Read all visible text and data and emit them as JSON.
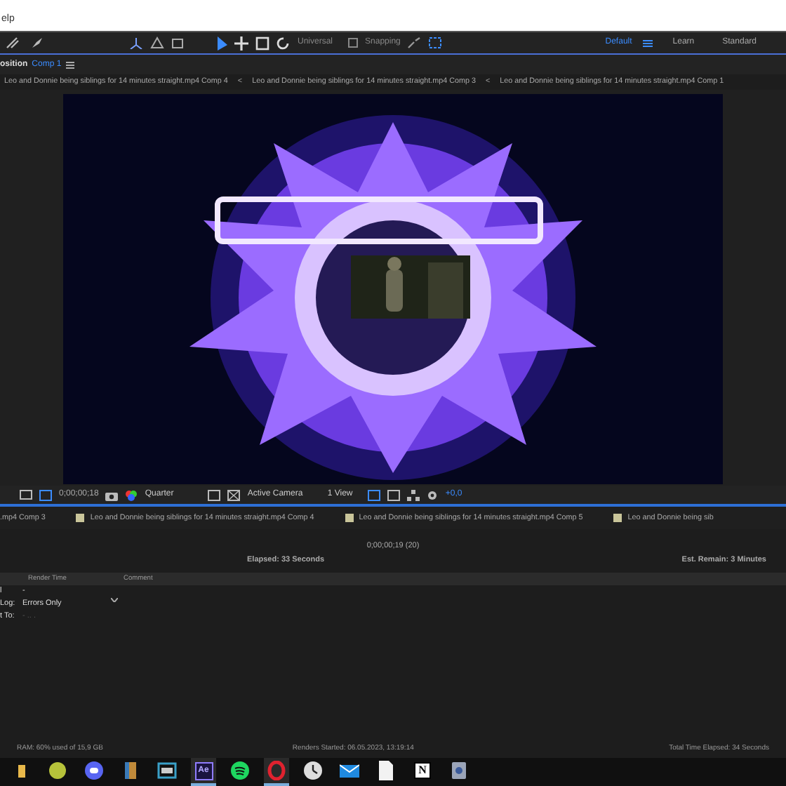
{
  "menu_bar": {
    "text": "elp"
  },
  "toolbar": {
    "universal": "Universal",
    "snapping": {
      "label": "Snapping",
      "checked": false
    },
    "workspaces": [
      {
        "label": "Default",
        "selected": true
      },
      {
        "label": "Learn",
        "selected": false
      },
      {
        "label": "Standard",
        "selected": false
      }
    ]
  },
  "composition_panel": {
    "title": "osition",
    "comp": "Comp 1",
    "tabs": [
      {
        "label": "Leo and Donnie being siblings for 14 minutes straight.mp4 Comp 4",
        "arrow": "<"
      },
      {
        "label": "Leo and Donnie being siblings for 14 minutes straight.mp4 Comp 3",
        "arrow": "<"
      },
      {
        "label": "Leo and Donnie being siblings for 14 minutes straight.mp4 Comp 1"
      }
    ],
    "controls": {
      "timecode": "0;00;00;18",
      "resolution": "Quarter",
      "camera": "Active Camera",
      "views": "1 View",
      "exposure": "+0,0"
    }
  },
  "render_queue": {
    "tabs": [
      {
        "label": ".mp4 Comp 3"
      },
      {
        "label": "Leo and Donnie being siblings for 14 minutes straight.mp4 Comp 4",
        "color": "#c9c59a"
      },
      {
        "label": "Leo and Donnie being siblings for 14 minutes straight.mp4 Comp 5",
        "color": "#c9c59a"
      },
      {
        "label": "Leo and Donnie being sib",
        "color": "#c9c59a"
      }
    ],
    "current_time": "0;00;00;19 (20)",
    "elapsed": "Elapsed:  33 Seconds",
    "remaining": "Est. Remain:  3 Minutes",
    "columns": [
      "Render Time",
      "Comment"
    ],
    "rows": [
      {
        "label": "l",
        "value": "-",
        "kind": "text"
      },
      {
        "label": "Log:",
        "value": "Errors Only",
        "kind": "dropdown"
      },
      {
        "label": "t To:",
        "value": "- .. .",
        "kind": "disabled"
      }
    ]
  },
  "status_bar": {
    "ram": "RAM:  60% used of 15,9 GB",
    "started": "Renders Started:  06.05.2023, 13:19:14",
    "total": "Total Time Elapsed:  34 Seconds"
  },
  "taskbar": [
    {
      "kind": "folder",
      "active": false
    },
    {
      "kind": "ball",
      "active": false
    },
    {
      "kind": "chat",
      "active": false
    },
    {
      "kind": "book",
      "active": false
    },
    {
      "kind": "film",
      "active": false
    },
    {
      "kind": "ae",
      "label": "Ae",
      "active": true
    },
    {
      "kind": "music",
      "active": false
    },
    {
      "kind": "ring",
      "active": true
    },
    {
      "kind": "clock",
      "active": false
    },
    {
      "kind": "mail",
      "active": false
    },
    {
      "kind": "page",
      "active": false
    },
    {
      "kind": "notion",
      "label": "N",
      "active": false
    },
    {
      "kind": "gear",
      "active": false
    }
  ]
}
